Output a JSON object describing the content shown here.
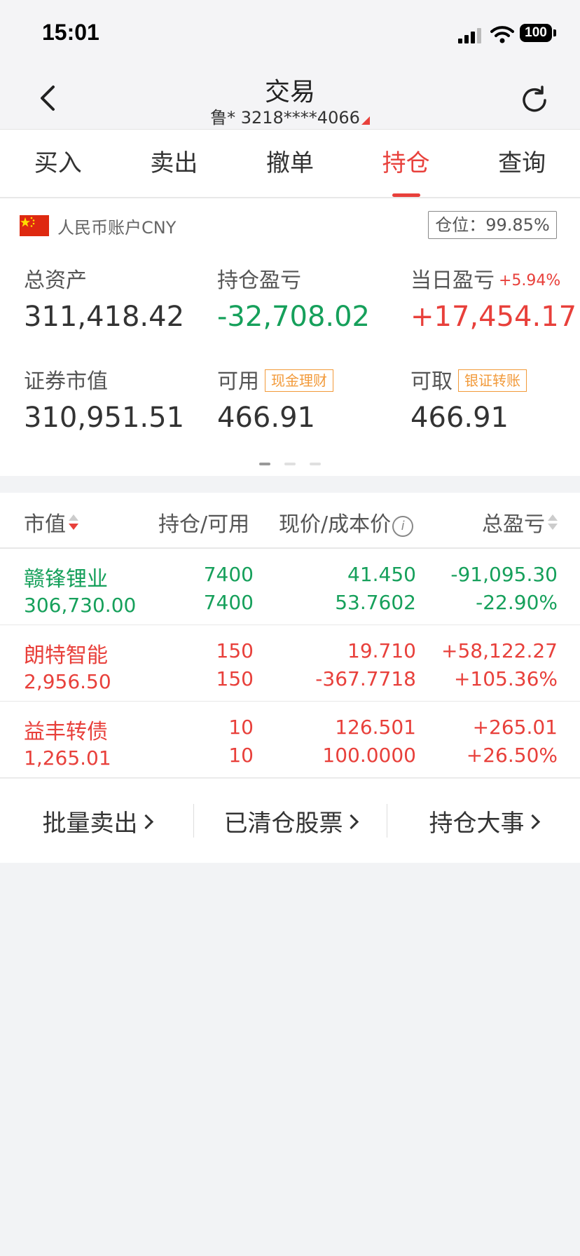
{
  "status": {
    "time": "15:01",
    "battery": "100"
  },
  "nav": {
    "title": "交易",
    "account": "鲁* 3218****4066"
  },
  "tabs": [
    "买入",
    "卖出",
    "撤单",
    "持仓",
    "查询"
  ],
  "active_tab": "持仓",
  "account_card": {
    "currency_label": "人民币账户CNY",
    "position_ratio": "仓位：99.85%",
    "total_assets": {
      "label": "总资产",
      "value": "311,418.42"
    },
    "position_pl": {
      "label": "持仓盈亏",
      "value": "-32,708.02"
    },
    "daily_pl": {
      "label": "当日盈亏",
      "pct": "+5.94%",
      "value": "+17,454.17"
    },
    "securities_value": {
      "label": "证券市值",
      "value": "310,951.51"
    },
    "available": {
      "label": "可用",
      "tag": "现金理财",
      "value": "466.91"
    },
    "withdrawable": {
      "label": "可取",
      "tag": "银证转账",
      "value": "466.91"
    }
  },
  "table": {
    "headers": {
      "market_value": "市值",
      "qty": "持仓/可用",
      "price": "现价/成本价",
      "pl": "总盈亏"
    },
    "rows": [
      {
        "name": "赣锋锂业",
        "market_value": "306,730.00",
        "qty": "7400",
        "available": "7400",
        "price": "41.450",
        "cost": "53.7602",
        "pl": "-91,095.30",
        "pl_pct": "-22.90%",
        "color": "#16a05b"
      },
      {
        "name": "朗特智能",
        "market_value": "2,956.50",
        "qty": "150",
        "available": "150",
        "price": "19.710",
        "cost": "-367.7718",
        "pl": "+58,122.27",
        "pl_pct": "+105.36%",
        "color": "#e8403b"
      },
      {
        "name": "益丰转债",
        "market_value": "1,265.01",
        "qty": "10",
        "available": "10",
        "price": "126.501",
        "cost": "100.0000",
        "pl": "+265.01",
        "pl_pct": "+26.50%",
        "color": "#e8403b"
      }
    ]
  },
  "actions": [
    "批量卖出",
    "已清仓股票",
    "持仓大事"
  ],
  "colors": {
    "accent_red": "#e8403b",
    "gain_green": "#16a05b",
    "tag_orange": "#f29a3a"
  }
}
